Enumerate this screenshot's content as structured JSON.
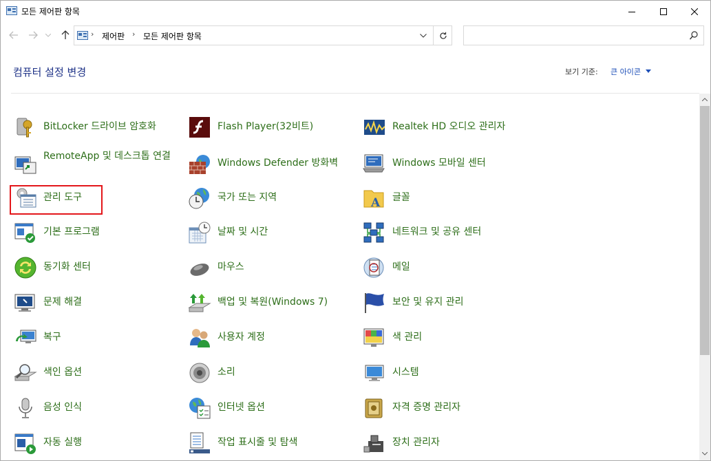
{
  "window": {
    "title": "모든 제어판 항목"
  },
  "address": {
    "crumbs": [
      "제어판",
      "모든 제어판 항목"
    ],
    "search_placeholder": ""
  },
  "header": {
    "title": "컴퓨터 설정 변경",
    "view_by_label": "보기 기준:",
    "view_by_value": "큰 아이콘"
  },
  "items": {
    "c1r1": "BitLocker 드라이브 암호화",
    "c1r2": "RemoteApp 및 데스크톱 연결",
    "c1r3": "관리 도구",
    "c1r4": "기본 프로그램",
    "c1r5": "동기화 센터",
    "c1r6": "문제 해결",
    "c1r7": "복구",
    "c1r8": "색인 옵션",
    "c1r9": "음성 인식",
    "c1r10": "자동 실행",
    "c2r1": "Flash Player(32비트)",
    "c2r2": "Windows Defender 방화벽",
    "c2r3": "국가 또는 지역",
    "c2r4": "날짜 및 시간",
    "c2r5": "마우스",
    "c2r6": "백업 및 복원(Windows 7)",
    "c2r7": "사용자 계정",
    "c2r8": "소리",
    "c2r9": "인터넷 옵션",
    "c2r10": "작업 표시줄 및 탐색",
    "c3r1": "Realtek HD 오디오 관리자",
    "c3r2": "Windows 모바일 센터",
    "c3r3": "글꼴",
    "c3r4": "네트워크 및 공유 센터",
    "c3r5": "메일",
    "c3r6": "보안 및 유지 관리",
    "c3r7": "색 관리",
    "c3r8": "시스템",
    "c3r9": "자격 증명 관리자",
    "c3r10": "장치 관리자"
  },
  "colors": {
    "link_green": "#2d6e19",
    "title_blue": "#1e3287",
    "highlight_red": "#e3161a"
  }
}
